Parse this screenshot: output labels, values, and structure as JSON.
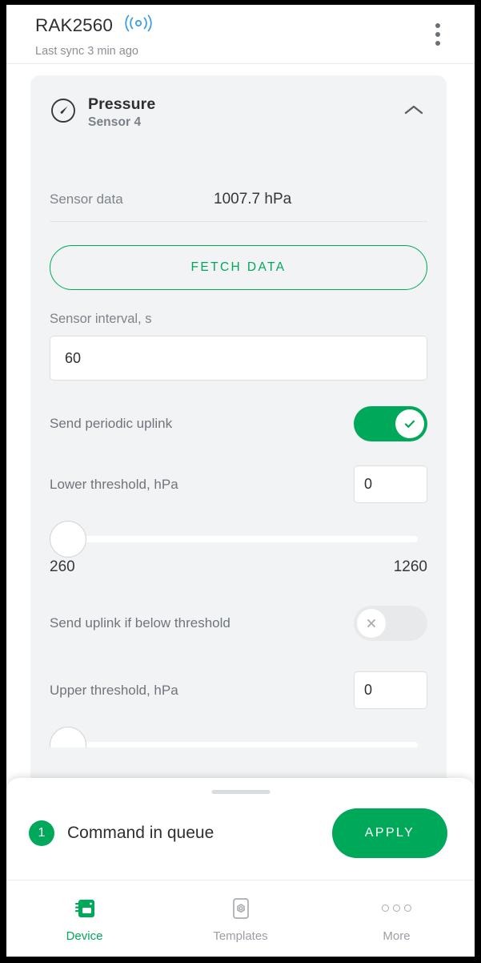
{
  "appbar": {
    "device_name": "RAK2560",
    "signal_icon": "broadcast-signal-icon",
    "last_sync": "Last sync 3 min ago",
    "menu_icon": "kebab-menu-icon",
    "signal_color": "#3a9fe8"
  },
  "card": {
    "icon": "pressure-gauge-icon",
    "title": "Pressure",
    "subtitle": "Sensor 4",
    "collapse_icon": "chevron-up-icon",
    "sensor_data_label": "Sensor data",
    "sensor_data_value": "1007.7 hPa",
    "fetch_button": "FETCH DATA",
    "interval_label": "Sensor interval, s",
    "interval_value": "60",
    "interval_placeholder": "60",
    "periodic_uplink_label": "Send periodic uplink",
    "periodic_uplink_state": "on",
    "periodic_uplink_icon": "check-icon",
    "lower_threshold_label": "Lower threshold, hPa",
    "lower_threshold_value": "0",
    "lower_threshold_placeholder": "0",
    "lower_slider_min": "260",
    "lower_slider_max": "1260",
    "below_threshold_label": "Send uplink if below threshold",
    "below_threshold_state": "off",
    "below_threshold_icon": "close-icon",
    "upper_threshold_label": "Upper threshold, hPa",
    "upper_threshold_value": "0",
    "upper_threshold_placeholder": "0"
  },
  "bottom_sheet": {
    "handle": "drag-handle",
    "queue_count": "1",
    "queue_text": "Command in queue",
    "apply_button": "APPLY"
  },
  "bottom_nav": {
    "items": [
      {
        "label": "Device",
        "icon": "device-board-icon",
        "active": true
      },
      {
        "label": "Templates",
        "icon": "template-hexagon-icon",
        "active": false
      },
      {
        "label": "More",
        "icon": "more-dots-icon",
        "active": false
      }
    ]
  },
  "colors": {
    "accent_green": "#00a85a",
    "signal_blue": "#3a9fe8",
    "card_bg": "#f1f3f4",
    "text_primary": "#2c2f33",
    "text_secondary": "#7e848b"
  }
}
